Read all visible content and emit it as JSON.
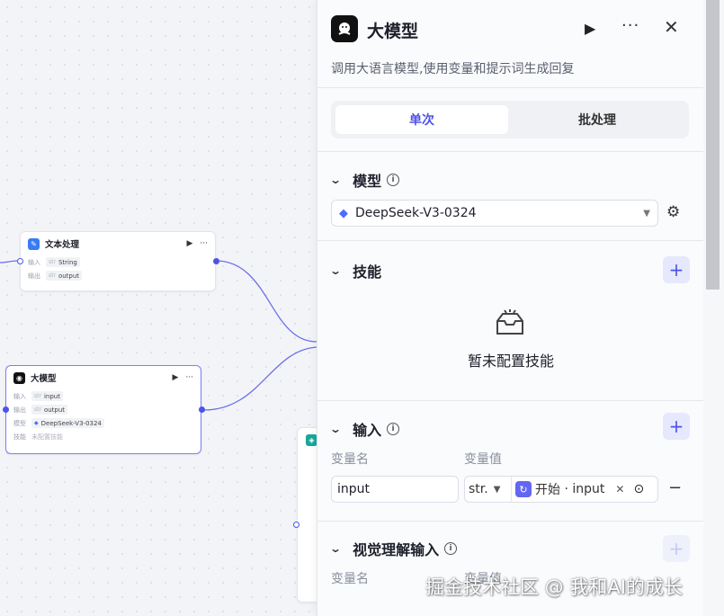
{
  "canvas": {
    "text_node": {
      "title": "文本处理",
      "rows": [
        {
          "key": "输入",
          "type": "str",
          "value": "String"
        },
        {
          "key": "输出",
          "type": "str",
          "value": "output"
        }
      ]
    },
    "llm_node": {
      "title": "大模型",
      "rows": [
        {
          "key": "输入",
          "type": "str",
          "value": "input"
        },
        {
          "key": "输出",
          "type": "str",
          "value": "output"
        },
        {
          "key": "模型",
          "value": "DeepSeek-V3-0324"
        },
        {
          "key": "技能",
          "value": "未配置技能"
        }
      ]
    },
    "accent_color": "#4d53e8"
  },
  "panel": {
    "title": "大模型",
    "description": "调用大语言模型,使用变量和提示词生成回复",
    "icons": {
      "run": "play-icon",
      "more": "more-icon",
      "close": "close-icon"
    },
    "tabs": [
      {
        "label": "单次",
        "active": true
      },
      {
        "label": "批处理",
        "active": false
      }
    ],
    "model_section": {
      "title": "模型",
      "selected_model": "DeepSeek-V3-0324"
    },
    "skills_section": {
      "title": "技能",
      "empty_text": "暂未配置技能"
    },
    "input_section": {
      "title": "输入",
      "col_name": "变量名",
      "col_value": "变量值",
      "rows": [
        {
          "name": "input",
          "type": "str.",
          "ref_node": "开始",
          "ref_var": "input"
        }
      ]
    },
    "vision_section": {
      "title": "视觉理解输入",
      "col_name": "变量名",
      "col_value": "变量值"
    }
  },
  "watermark": "掘金技术社区 @ 我和AI的成长"
}
